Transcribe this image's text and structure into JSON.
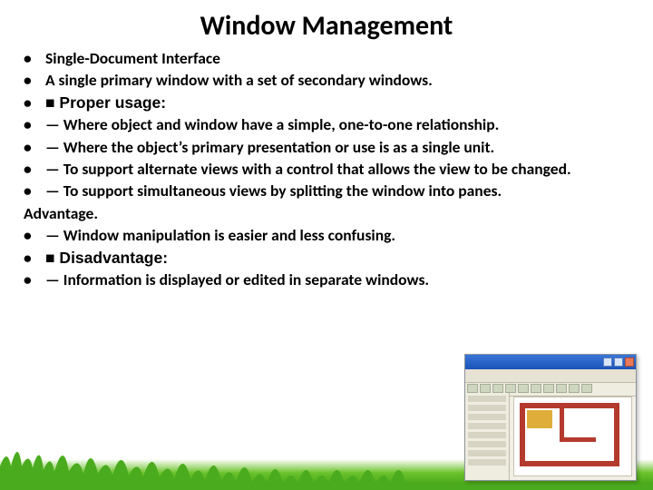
{
  "title": "Window Management",
  "bullets": [
    "Single-Document Interface",
    " A single primary window with a set of secondary windows.",
    "■ Proper usage:",
    "— Where object and window have a simple, one-to-one relationship.",
    "— Where the object’s primary presentation or use is as a single unit.",
    "— To support alternate views with a control that allows the view to be changed.",
    "— To support simultaneous views by splitting the window into panes."
  ],
  "advantage_label": "Advantage.",
  "bullets2": [
    "— Window manipulation is easier and less confusing.",
    "■ Disadvantage:",
    "— Information is displayed or edited in separate windows."
  ],
  "bullet_char": "•"
}
